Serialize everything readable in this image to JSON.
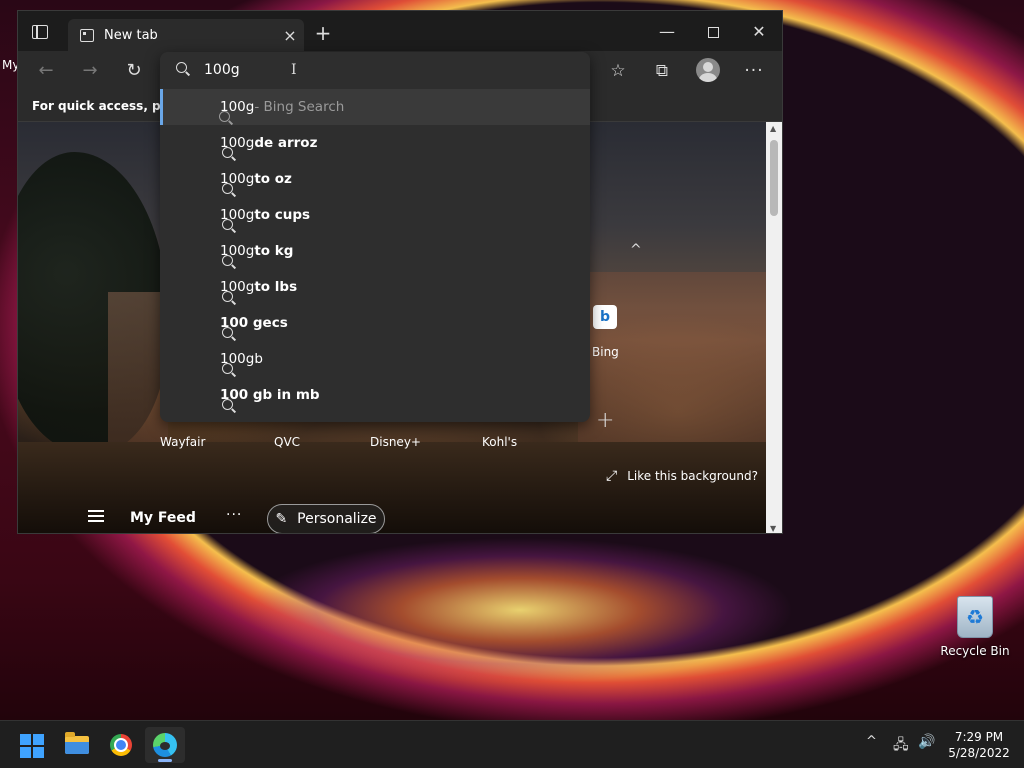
{
  "desktop": {
    "partial_label": "My",
    "recycle_bin_label": "Recycle Bin"
  },
  "browser": {
    "tab": {
      "title": "New tab",
      "close_glyph": "×"
    },
    "new_tab_glyph": "+",
    "window_controls": {
      "minimize": "—",
      "close": "✕"
    },
    "toolbar": {
      "back_glyph": "←",
      "forward_glyph": "→",
      "refresh_glyph": "↻",
      "favorites_glyph": "☆",
      "collections_glyph": "⧉",
      "more_glyph": "···"
    },
    "favbar_text": "For quick access, place your favorites here on the favorites bar.",
    "omnibox": {
      "query": "100g",
      "cursor_glyph": "I",
      "suggestions": [
        {
          "prefix": "100g",
          "suffix": " - Bing Search"
        },
        {
          "prefix": "100g",
          "suffix": " de arroz"
        },
        {
          "prefix": "100g",
          "suffix": " to oz"
        },
        {
          "prefix": "100g",
          "suffix": " to cups"
        },
        {
          "prefix": "100g",
          "suffix": " to kg"
        },
        {
          "prefix": "100g",
          "suffix": " to lbs"
        },
        {
          "prefix": "",
          "suffix": "100 gecs"
        },
        {
          "prefix": "100gb",
          "suffix": ""
        },
        {
          "prefix": "",
          "suffix": "100 gb in mb"
        }
      ]
    },
    "page": {
      "collapse_glyph": "^",
      "bing_tile_letter": "b",
      "bing_label": "Bing",
      "add_site_glyph": "+",
      "sites": [
        "Wayfair",
        "QVC",
        "Disney+",
        "Kohl's"
      ],
      "like_background": "Like this background?",
      "like_icon_glyph": "⤢",
      "feed_title": "My Feed",
      "feed_more": "···",
      "personalize_label": "Personalize",
      "personalize_icon_glyph": "✎",
      "scroll_up_glyph": "▲",
      "scroll_down_glyph": "▼"
    }
  },
  "taskbar": {
    "tray_chevron": "^",
    "network_glyph": "🖧",
    "volume_glyph": "🔊",
    "time": "7:29 PM",
    "date": "5/28/2022"
  },
  "colors": {
    "accent": "#6aa7e8",
    "start_blue": "#3fa3ff",
    "omnibox_bg": "#2e2e2e"
  }
}
